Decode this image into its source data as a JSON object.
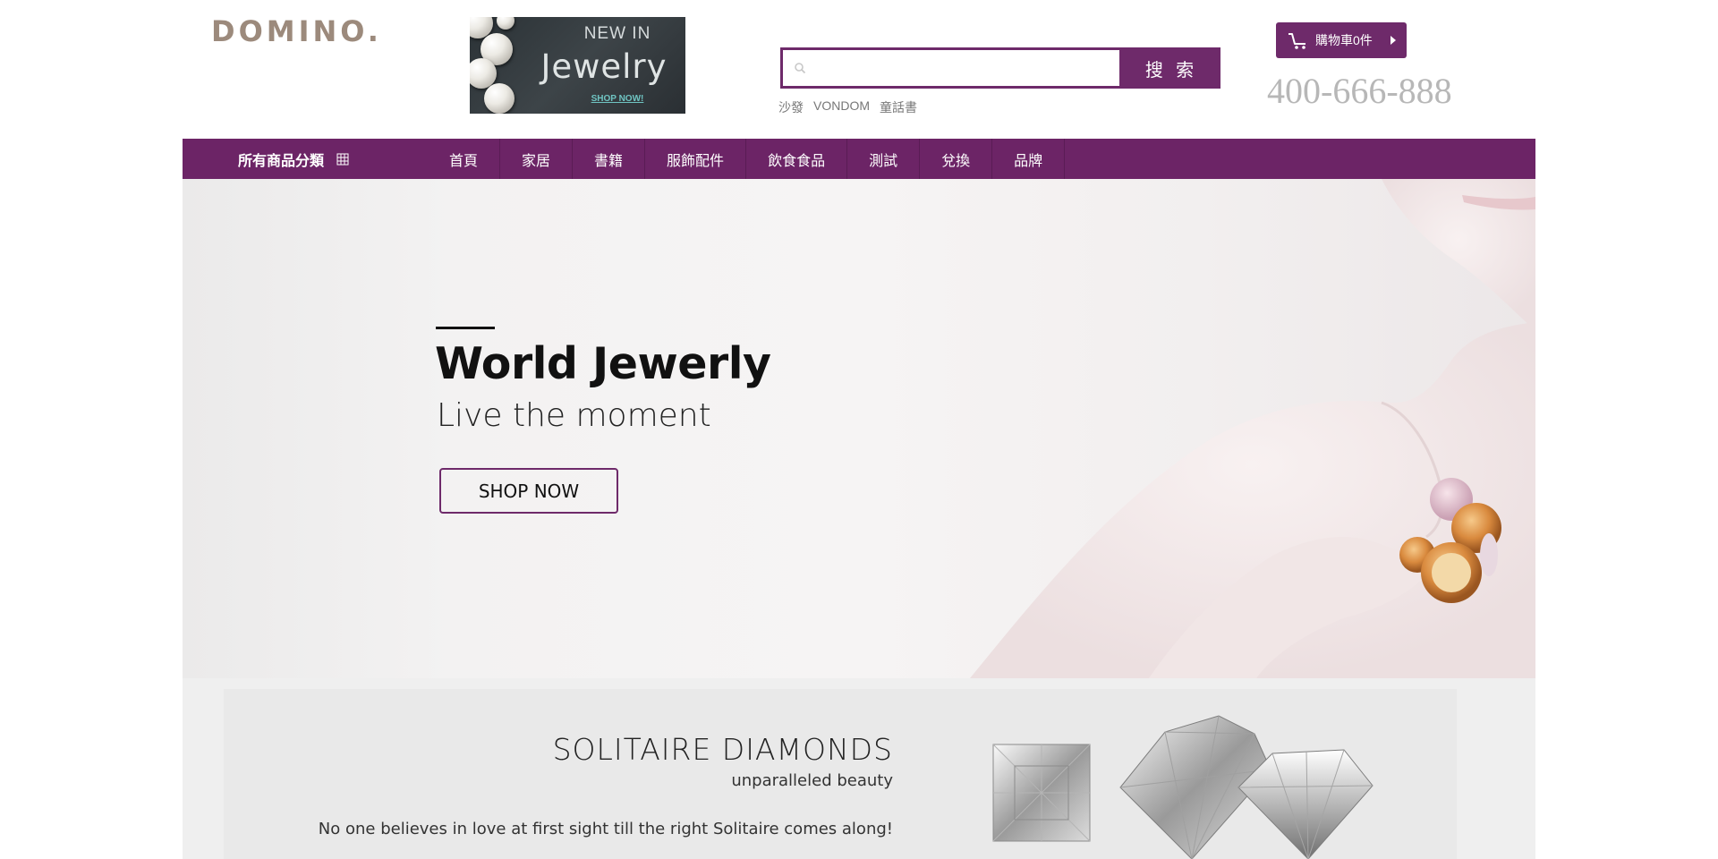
{
  "header": {
    "logo": "DOMINO.",
    "ad": {
      "line1": "NEW IN",
      "title": "Jewelry",
      "cta": "SHOP NOW!"
    },
    "search": {
      "placeholder": "",
      "button_label": "搜 索",
      "hot_tags": [
        "沙發",
        "VONDOM",
        "童話書"
      ]
    },
    "cart": {
      "label": "購物車0件"
    },
    "hotline": "400-666-888"
  },
  "nav": {
    "all_categories": "所有商品分類",
    "items": [
      "首頁",
      "家居",
      "書籍",
      "服飾配件",
      "飲食食品",
      "測試",
      "兌換",
      "品牌"
    ]
  },
  "hero": {
    "title": "World Jewerly",
    "subtitle": "Live the moment",
    "button_label": "SHOP NOW"
  },
  "diamonds": {
    "title": "SOLITAIRE DIAMONDS",
    "subtitle": "unparalleled beauty",
    "text": "No one believes in love at first sight till the right Solitaire comes along!"
  },
  "colors": {
    "brand": "#6e2a6a",
    "logo": "#9c8a7c",
    "hotline": "#b7b7b7"
  },
  "icons": [
    "search-icon",
    "cart-icon",
    "grid-icon",
    "chevron-right-icon"
  ]
}
